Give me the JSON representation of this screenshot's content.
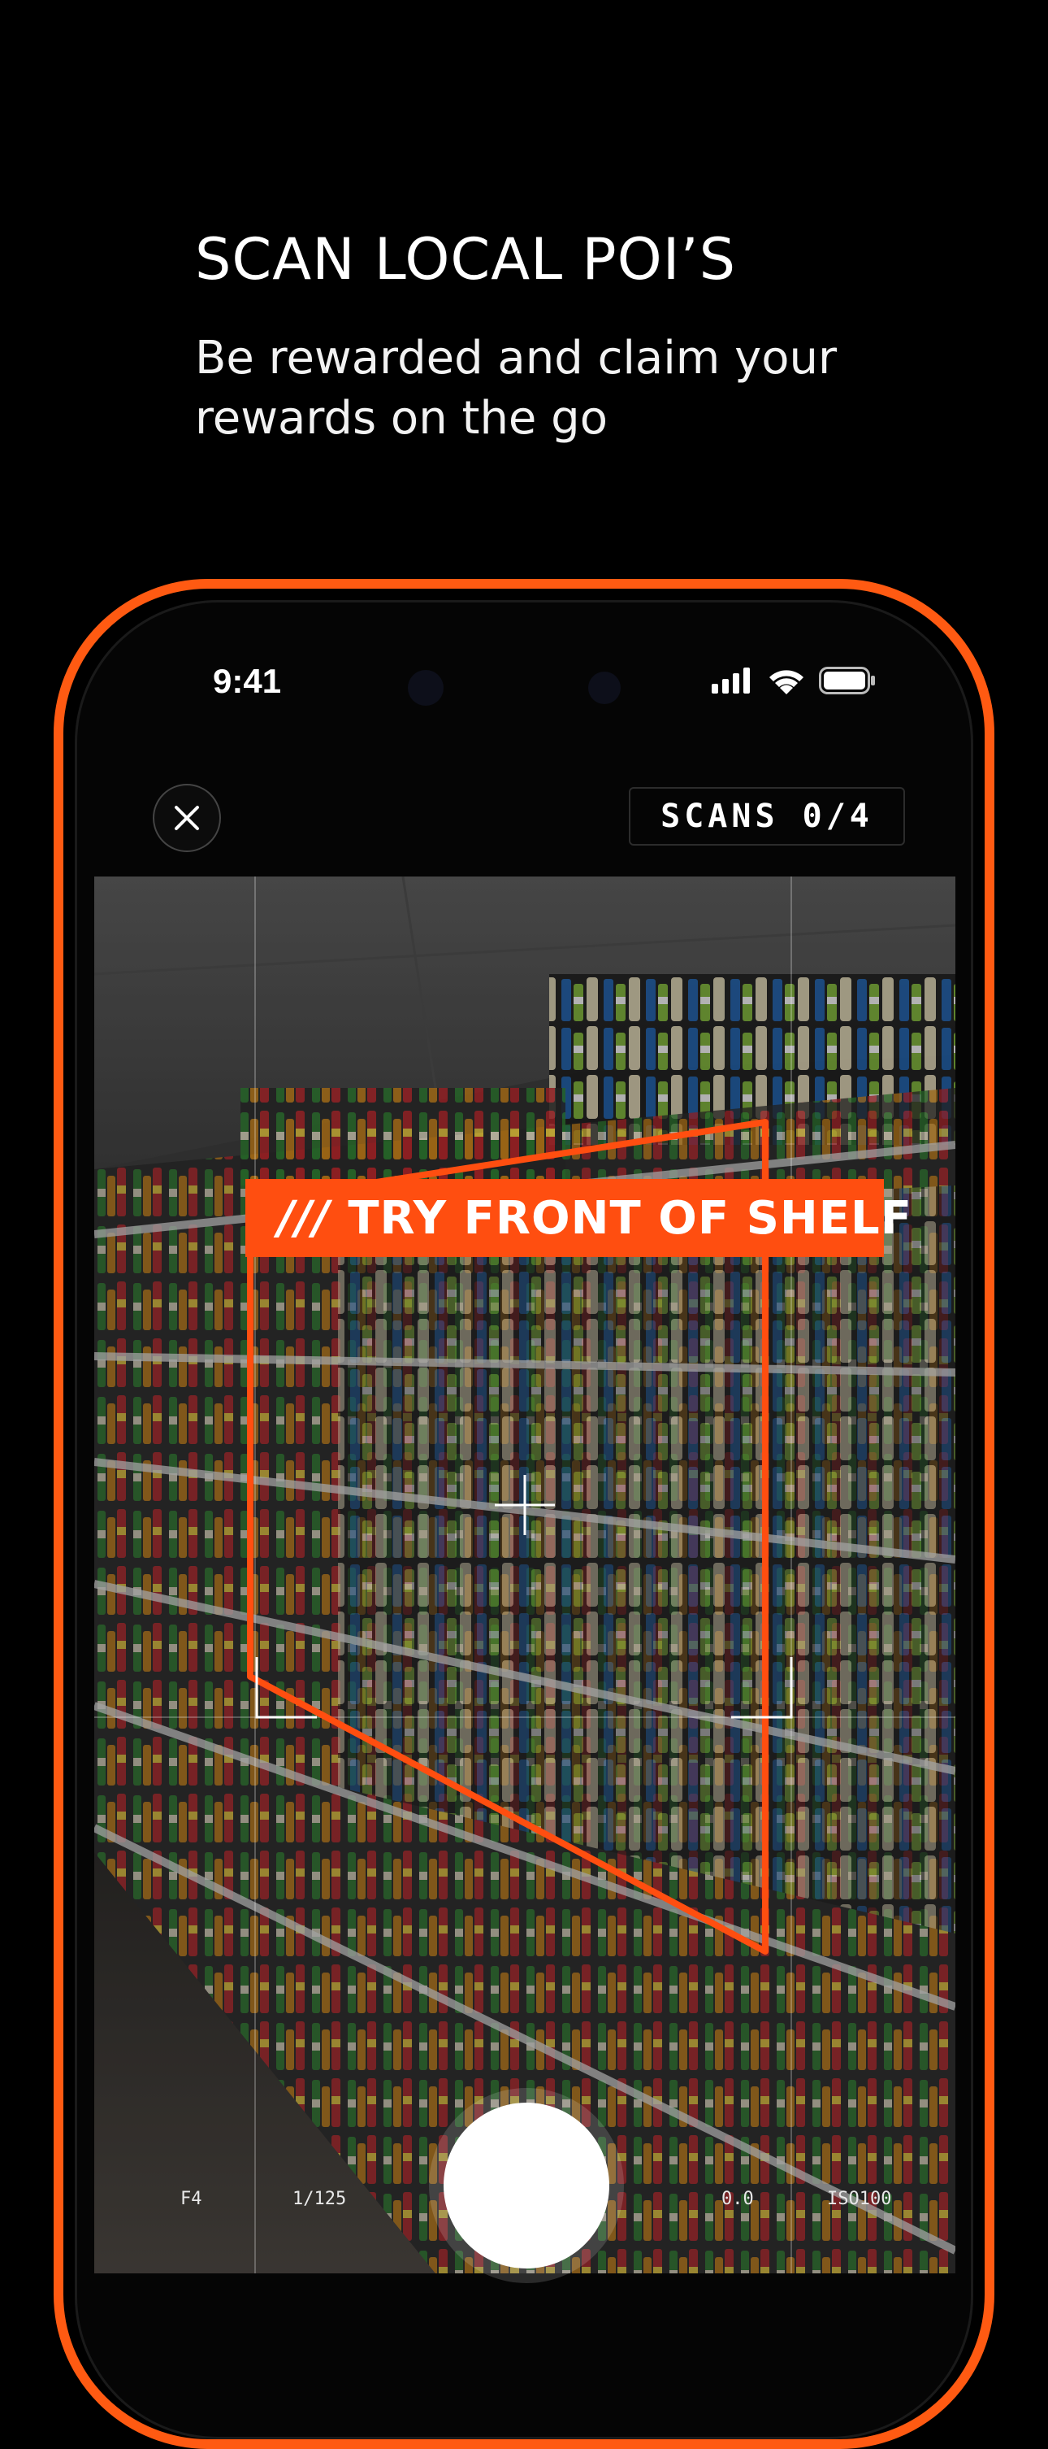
{
  "header": {
    "title": "SCAN LOCAL POI’S",
    "subtitle": "Be rewarded and claim your rewards on the go"
  },
  "status_bar": {
    "time": "9:41",
    "icons": [
      "cellular-signal-icon",
      "wifi-icon",
      "battery-icon"
    ]
  },
  "scanner": {
    "scans_label": "SCANS 0/4",
    "hint": "TRY FRONT OF SHELF",
    "hint_prefix": "///",
    "close_icon": "close-icon"
  },
  "camera_settings": {
    "aperture": "F4",
    "shutter_speed": "1/125",
    "exposure": "0.0",
    "iso": "ISO100"
  },
  "colors": {
    "accent": "#ff5a12",
    "background": "#000000"
  }
}
